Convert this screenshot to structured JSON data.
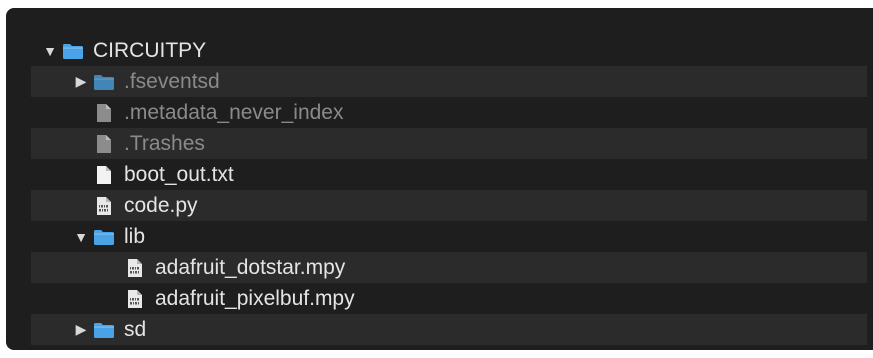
{
  "colors": {
    "panel_bg": "#1e1e1e",
    "row_alt_bg": "#2b2b2b",
    "text": "#e4e4e4",
    "text_dim": "#8a8a8a",
    "folder_blue": "#4aa3e6"
  },
  "tree": {
    "rows": [
      {
        "label": "CIRCUITPY",
        "level": 0,
        "disclosure": "expanded",
        "icon": "folder-icon",
        "dim": false
      },
      {
        "label": ".fseventsd",
        "level": 1,
        "disclosure": "collapsed",
        "icon": "folder-icon",
        "dim": true
      },
      {
        "label": ".metadata_never_index",
        "level": 1,
        "disclosure": "none",
        "icon": "file-icon",
        "dim": true
      },
      {
        "label": ".Trashes",
        "level": 1,
        "disclosure": "none",
        "icon": "file-icon",
        "dim": true
      },
      {
        "label": "boot_out.txt",
        "level": 1,
        "disclosure": "none",
        "icon": "file-icon",
        "dim": false
      },
      {
        "label": "code.py",
        "level": 1,
        "disclosure": "none",
        "icon": "binary-file-icon",
        "dim": false
      },
      {
        "label": "lib",
        "level": 1,
        "disclosure": "expanded",
        "icon": "folder-icon",
        "dim": false
      },
      {
        "label": "adafruit_dotstar.mpy",
        "level": 2,
        "disclosure": "none",
        "icon": "binary-file-icon",
        "dim": false
      },
      {
        "label": "adafruit_pixelbuf.mpy",
        "level": 2,
        "disclosure": "none",
        "icon": "binary-file-icon",
        "dim": false
      },
      {
        "label": "sd",
        "level": 1,
        "disclosure": "collapsed",
        "icon": "folder-icon",
        "dim": false
      }
    ]
  }
}
